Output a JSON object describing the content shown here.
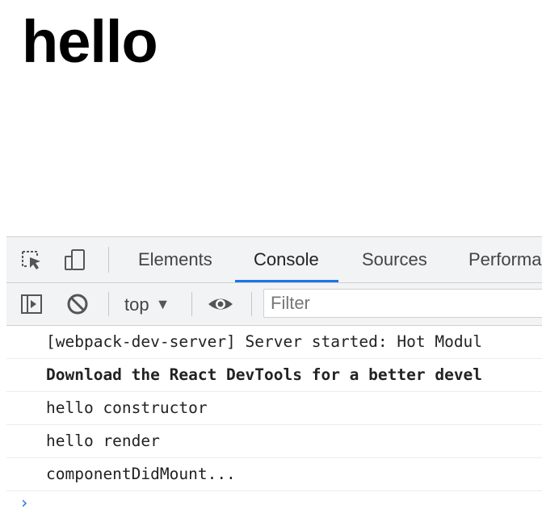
{
  "page": {
    "heading": "hello"
  },
  "devtools": {
    "tabs": [
      {
        "label": "Elements",
        "active": false
      },
      {
        "label": "Console",
        "active": true
      },
      {
        "label": "Sources",
        "active": false
      },
      {
        "label": "Performa",
        "active": false
      }
    ],
    "icons": {
      "inspect": "inspect-element-icon",
      "device": "device-toolbar-icon"
    },
    "console_toolbar": {
      "sidebar_icon": "sidebar-toggle-icon",
      "clear_icon": "clear-console-icon",
      "context": "top",
      "eye_icon": "live-expression-icon",
      "filter_placeholder": "Filter"
    },
    "console_messages": [
      {
        "text": "[webpack-dev-server] Server started: Hot Modul",
        "bold": false
      },
      {
        "text": "Download the React DevTools for a better devel",
        "bold": true
      },
      {
        "text": "hello constructor",
        "bold": false
      },
      {
        "text": "hello render",
        "bold": false
      },
      {
        "text": "componentDidMount...",
        "bold": false
      }
    ],
    "prompt_symbol": "›",
    "accent_color": "#1a73e8"
  }
}
